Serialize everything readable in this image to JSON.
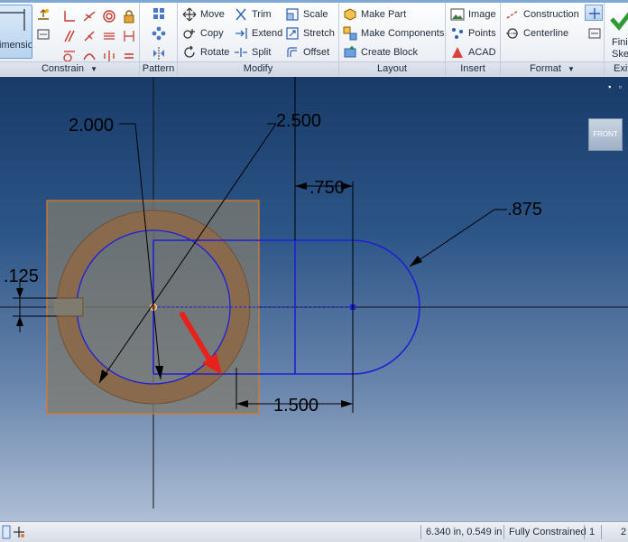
{
  "ribbon": {
    "constrain": {
      "dimension_label": "Dimension",
      "footer": "Constrain",
      "dropdown_arrow": "▼"
    },
    "pattern": {
      "footer": "Pattern"
    },
    "modify": {
      "footer": "Modify",
      "move": "Move",
      "trim": "Trim",
      "scale": "Scale",
      "copy": "Copy",
      "extend": "Extend",
      "stretch": "Stretch",
      "rotate": "Rotate",
      "split": "Split",
      "offset": "Offset"
    },
    "layout": {
      "footer": "Layout",
      "make_part": "Make Part",
      "make_components": "Make Components",
      "create_block": "Create Block"
    },
    "insert": {
      "footer": "Insert",
      "image": "Image",
      "points": "Points",
      "acad": "ACAD"
    },
    "format": {
      "footer": "Format",
      "dropdown_arrow": "▼",
      "construction": "Construction",
      "centerline": "Centerline"
    },
    "exit": {
      "finish_label": "Finish Sketch",
      "footer": "Exit"
    }
  },
  "canvas": {
    "dimensions": {
      "dia_outer": "2.000",
      "dia_large": "2.500",
      "offset_top": ".750",
      "radius_end": ".875",
      "gap_width": ".125",
      "length": "1.500"
    },
    "viewcube_label": "FRONT",
    "window_controls": "▪ ▫"
  },
  "status": {
    "coords": "6.340 in, 0.549 in",
    "constraint_state": "Fully Constrained",
    "count_a": "1",
    "count_b": "2"
  },
  "colors": {
    "sketch_blue": "#1f1fd6",
    "annotation_red": "#e8221b",
    "face_orange": "#e07a24",
    "ring_brown": "#8a6a4c",
    "canvas_top": "#183b69"
  }
}
